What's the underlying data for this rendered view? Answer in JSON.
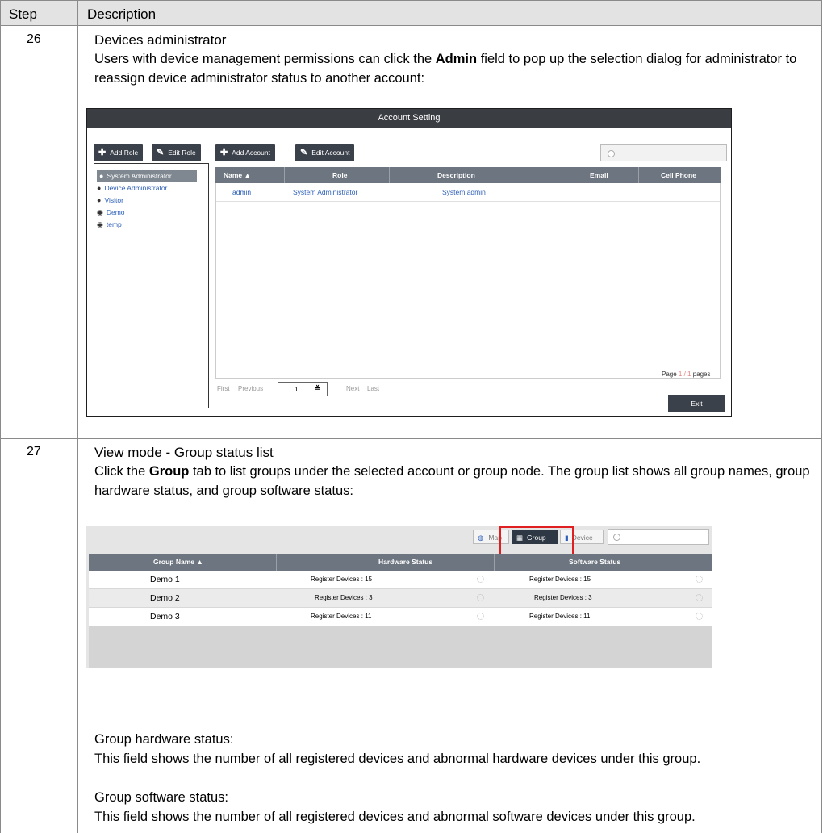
{
  "header": {
    "step": "Step",
    "description": "Description"
  },
  "row26": {
    "step": "26",
    "title": "Devices administrator",
    "text_before": "Users with device management permissions can click the ",
    "text_bold": "Admin",
    "text_after": " field to pop up the selection dialog for administrator to reassign device administrator status to another account:"
  },
  "account_window": {
    "title": "Account Setting",
    "add_role": "Add Role",
    "edit_role": "Edit Role",
    "add_account": "Add Account",
    "edit_account": "Edit Account",
    "roles": [
      "System Administrator",
      "Device Administrator",
      "Visitor",
      "Demo",
      "temp"
    ],
    "columns": [
      "Name ▲",
      "Role",
      "Description",
      "Email",
      "Cell Phone"
    ],
    "rows": [
      {
        "name": "admin",
        "role": "System Administrator",
        "description": "System admin",
        "email": "",
        "phone": ""
      }
    ],
    "pager": {
      "first": "First",
      "previous": "Previous",
      "page_value": "1",
      "next": "Next",
      "last": "Last",
      "page_prefix": "Page ",
      "page_current": "1 / 1",
      "page_suffix": " pages"
    },
    "exit": "Exit"
  },
  "row27": {
    "step": "27",
    "title": "View mode - Group status list",
    "text_before": "Click the ",
    "text_bold": "Group",
    "text_after": " tab to list groups under the selected account or group node. The group list shows all group names, group hardware status, and group software status:"
  },
  "group_window": {
    "tabs": {
      "map": "Map",
      "group": "Group",
      "device": "Device"
    },
    "columns": [
      "Group Name ▲",
      "Hardware Status",
      "Software Status"
    ],
    "rows": [
      {
        "name": "Demo 1",
        "hardware": "Register Devices : 15",
        "software": "Register Devices : 15"
      },
      {
        "name": "Demo 2",
        "hardware": "Register Devices : 3",
        "software": "Register Devices : 3"
      },
      {
        "name": "Demo 3",
        "hardware": "Register Devices : 11",
        "software": "Register Devices : 11"
      }
    ]
  },
  "notes": {
    "hw_title": "Group hardware status:",
    "hw_text": "This field shows the number of all registered devices and abnormal hardware devices under this group.",
    "sw_title": "Group software status:",
    "sw_text": "This field shows the number of all registered devices and abnormal software devices under this group."
  },
  "colors": {
    "highlight_red": "#e02020",
    "link_blue": "#2d5fb8",
    "header_dark": "#3a3d42"
  }
}
